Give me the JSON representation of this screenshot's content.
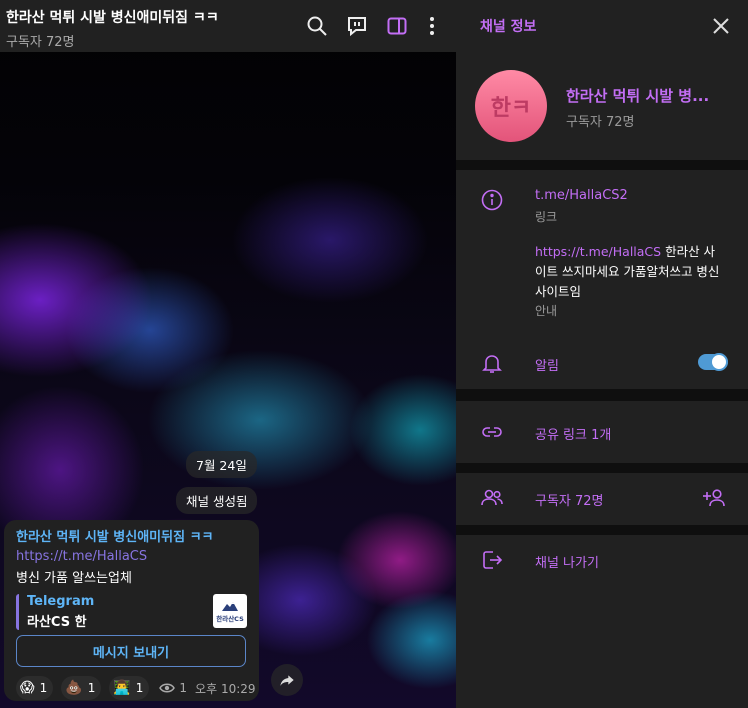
{
  "chat": {
    "title": "한라산 먹튀 시발 병신애미뒤짐 ㅋㅋ",
    "subtitle": "구독자 72명",
    "date_pill": "7월 24일",
    "created_pill": "채널 생성됨"
  },
  "message": {
    "title": "한라산 먹튀 시발 병신애미뒤짐 ㅋㅋ",
    "link": "https://t.me/HallaCS",
    "text": "병신 가품 알쓰는업체",
    "preview": {
      "site": "Telegram",
      "title": "라산CS 한",
      "thumb_text": "한라산CS"
    },
    "button_label": "메시지 보내기",
    "reactions": [
      {
        "emoji": "😱",
        "count": "1"
      },
      {
        "emoji": "💩",
        "count": "1"
      },
      {
        "emoji": "👨‍💻",
        "count": "1"
      }
    ],
    "views": "1",
    "time": "오후 10:29"
  },
  "panel": {
    "header_title": "채널 정보",
    "avatar_text": "한ㅋ",
    "channel_name": "한라산 먹튀 시발 병...",
    "subscribers": "구독자 72명",
    "link": "t.me/HallaCS2",
    "link_caption": "링크",
    "about_link": "https://t.me/HallaCS",
    "about_text": " 한라산 사이트 쓰지마세요 가품알처쓰고 병신사이트임",
    "about_caption": "안내",
    "notifications_label": "알림",
    "notifications_on": true,
    "share_links": "공유 링크 1개",
    "members": "구독자 72명",
    "leave": "채널 나가기"
  },
  "colors": {
    "accent": "#c36ef5",
    "message_link": "#8774e1",
    "message_title": "#5eb5f7",
    "panel_bg": "#212121"
  }
}
